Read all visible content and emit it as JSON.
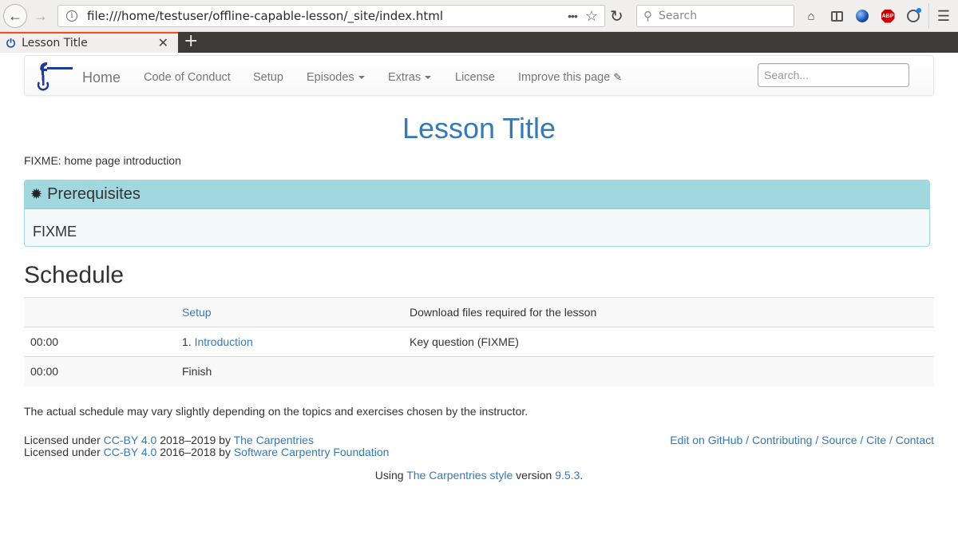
{
  "browser": {
    "url": "file:///home/testuser/offline-capable-lesson/_site/index.html",
    "search_placeholder": "Search",
    "tab_title": "Lesson Title",
    "icons": {
      "back": "arrow-left-icon",
      "forward": "arrow-right-icon",
      "info": "info-icon",
      "page_actions": "more-dots-icon",
      "bookmark": "star-icon",
      "reload": "reload-icon",
      "home": "home-icon",
      "sidebar": "sidebar-icon",
      "extension_globe": "globe-icon",
      "adblock": "abp-icon",
      "account": "account-icon",
      "menu": "hamburger-menu-icon"
    },
    "abp_label": "ABP",
    "new_tab_label": "+"
  },
  "navbar": {
    "brand": "Home",
    "links": [
      {
        "label": "Code of Conduct"
      },
      {
        "label": "Setup"
      },
      {
        "label": "Episodes",
        "dropdown": true
      },
      {
        "label": "Extras",
        "dropdown": true
      },
      {
        "label": "License"
      },
      {
        "label": "Improve this page"
      }
    ],
    "search_placeholder": "Search..."
  },
  "main": {
    "title": "Lesson Title",
    "intro": "FIXME: home page introduction",
    "prerequisites": {
      "title": "Prerequisites",
      "body": "FIXME"
    },
    "schedule_heading": "Schedule",
    "schedule": [
      {
        "time": "",
        "prefix": "",
        "episode": "Setup",
        "episode_is_link": true,
        "description": "Download files required for the lesson"
      },
      {
        "time": "00:00",
        "prefix": "1. ",
        "episode": "Introduction",
        "episode_is_link": true,
        "description": "Key question (FIXME)"
      },
      {
        "time": "00:00",
        "prefix": "",
        "episode": "Finish",
        "episode_is_link": false,
        "description": ""
      }
    ],
    "schedule_note": "The actual schedule may vary slightly depending on the topics and exercises chosen by the instructor."
  },
  "footer": {
    "license_lines": [
      {
        "prefix": "Licensed under ",
        "license": "CC-BY 4.0",
        "middle": " 2018–2019 by ",
        "holder": "The Carpentries"
      },
      {
        "prefix": "Licensed under ",
        "license": "CC-BY 4.0",
        "middle": " 2016–2018 by ",
        "holder": "Software Carpentry Foundation"
      }
    ],
    "links": [
      "Edit on GitHub",
      "Contributing",
      "Source",
      "Cite",
      "Contact"
    ],
    "separator": " / ",
    "using_prefix": "Using ",
    "style_name": "The Carpentries style",
    "version_word": " version ",
    "version": "9.5.3",
    "suffix": "."
  },
  "colors": {
    "link": "#337ab7",
    "prereq_header": "#a1d7de",
    "prereq_body": "#f1f9fb",
    "tab_accent": "#e95420",
    "tabstrip": "#3c3b37"
  }
}
